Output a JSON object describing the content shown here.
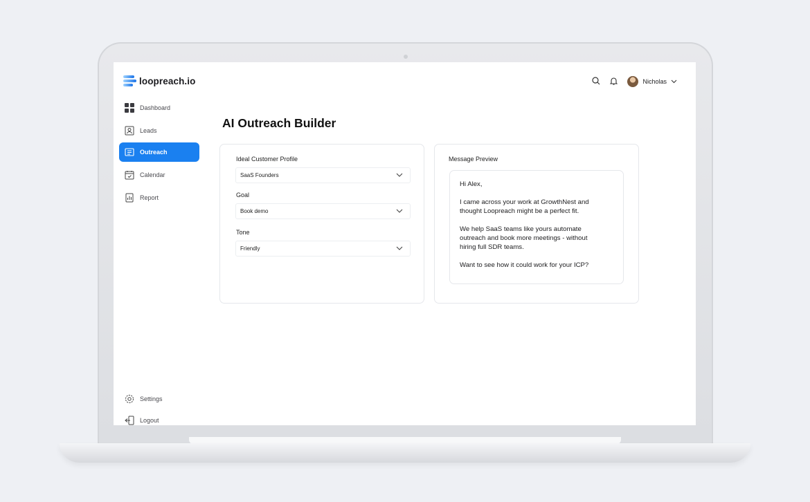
{
  "brand": {
    "name": "loopreach.io"
  },
  "sidebar": {
    "items": [
      {
        "label": "Dashboard",
        "icon": "dashboard-icon"
      },
      {
        "label": "Leads",
        "icon": "leads-icon"
      },
      {
        "label": "Outreach",
        "icon": "outreach-icon",
        "active": true
      },
      {
        "label": "Calendar",
        "icon": "calendar-icon"
      },
      {
        "label": "Report",
        "icon": "report-icon"
      }
    ],
    "bottom": [
      {
        "label": "Settings",
        "icon": "gear-icon"
      },
      {
        "label": "Logout",
        "icon": "logout-icon"
      }
    ]
  },
  "header": {
    "user_name": "Nicholas"
  },
  "main": {
    "title": "AI Outreach Builder",
    "form": {
      "icp": {
        "label": "Ideal Customer Profile",
        "value": "SaaS Founders"
      },
      "goal": {
        "label": "Goal",
        "value": "Book demo"
      },
      "tone": {
        "label": "Tone",
        "value": "Friendly"
      }
    },
    "preview": {
      "label": "Message Preview",
      "paragraphs": [
        "Hi Alex,",
        "I came across your work at GrowthNest and\nthought Loopreach might be a perfect fit.",
        "We help SaaS teams like yours automate\noutreach and book more meetings - without\nhiring full SDR teams.",
        "Want to see how it could work for your ICP?"
      ]
    }
  },
  "colors": {
    "accent": "#1a80f0",
    "background": "#eef0f4"
  }
}
